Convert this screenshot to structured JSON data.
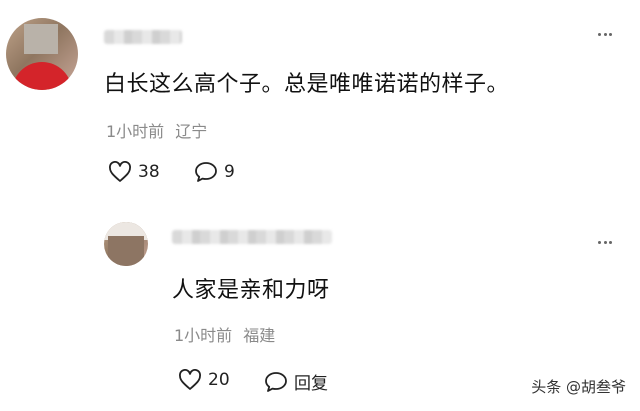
{
  "comment1": {
    "text": "白长这么高个子。总是唯唯诺诺的样子。",
    "time": "1小时前",
    "location": "辽宁",
    "likes": "38",
    "replies": "9"
  },
  "comment2": {
    "text": "人家是亲和力呀",
    "time": "1小时前",
    "location": "福建",
    "likes": "20",
    "reply_label": "回复"
  },
  "watermark": "头条 @胡叁爷",
  "icons": {
    "like": "heart-outline-icon",
    "reply": "speech-bubble-icon",
    "more": "more-horizontal-icon"
  }
}
